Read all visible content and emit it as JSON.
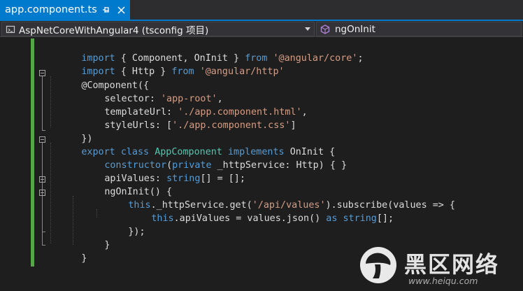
{
  "tab": {
    "title": "app.component.ts",
    "pin_icon": "pin-icon",
    "close_icon": "close-icon",
    "accent": "#007acc"
  },
  "navbar": {
    "project": "AspNetCoreWithAngular4 (tsconfig 项目)",
    "member": "ngOnInit"
  },
  "code": {
    "l1": [
      "import",
      " { Component, OnInit } ",
      "from",
      " ",
      "'@angular/core'",
      ";"
    ],
    "l2": [
      "import",
      " { Http } ",
      "from",
      " ",
      "'@angular/http'"
    ],
    "l3": [
      "@Component({"
    ],
    "l4": [
      "selector: ",
      "'app-root'",
      ","
    ],
    "l5": [
      "templateUrl: ",
      "'./app.component.html'",
      ","
    ],
    "l6": [
      "styleUrls: [",
      "'./app.component.css'",
      "]"
    ],
    "l7": [
      "})"
    ],
    "l8": [
      "export",
      " ",
      "class",
      " ",
      "AppComponent",
      " ",
      "implements",
      " ",
      "OnInit",
      " {"
    ],
    "l9": [
      "constructor",
      "(",
      "private",
      " _httpService: ",
      "Http",
      ") { }"
    ],
    "l10": [
      "apiValues: ",
      "string",
      "[] = [];"
    ],
    "l11": [
      "ngOnInit() {"
    ],
    "l12": [
      "this",
      "._httpService.get(",
      "'/api/values'",
      ").subscribe(values => {"
    ],
    "l13": [
      "this",
      ".apiValues = values.json() ",
      "as",
      " ",
      "string",
      "[];"
    ],
    "l14": [
      "});"
    ],
    "l15": [
      "}"
    ],
    "l16": [
      "}"
    ]
  },
  "watermark": {
    "title": "黑区网络",
    "url": "www.heiqu.com"
  }
}
